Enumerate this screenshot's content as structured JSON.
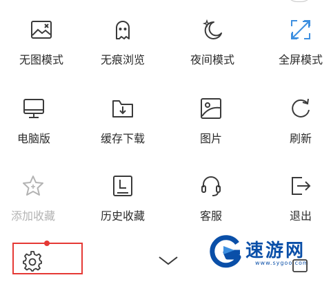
{
  "menu": {
    "rows": [
      [
        {
          "label": "无图模式",
          "icon": "no-image-icon",
          "enabled": true,
          "accent": false
        },
        {
          "label": "无痕浏览",
          "icon": "ghost-icon",
          "enabled": true,
          "accent": false
        },
        {
          "label": "夜间模式",
          "icon": "moon-icon",
          "enabled": true,
          "accent": false
        },
        {
          "label": "全屏模式",
          "icon": "fullscreen-icon",
          "enabled": true,
          "accent": true
        }
      ],
      [
        {
          "label": "电脑版",
          "icon": "monitor-icon",
          "enabled": true,
          "accent": false
        },
        {
          "label": "缓存下载",
          "icon": "download-folder-icon",
          "enabled": true,
          "accent": false
        },
        {
          "label": "图片",
          "icon": "image-icon",
          "enabled": true,
          "accent": false
        },
        {
          "label": "刷新",
          "icon": "refresh-icon",
          "enabled": true,
          "accent": false
        }
      ],
      [
        {
          "label": "添加收藏",
          "icon": "star-icon",
          "enabled": false,
          "accent": false
        },
        {
          "label": "历史收藏",
          "icon": "history-icon",
          "enabled": true,
          "accent": false
        },
        {
          "label": "客服",
          "icon": "headset-icon",
          "enabled": true,
          "accent": false
        },
        {
          "label": "退出",
          "icon": "exit-icon",
          "enabled": true,
          "accent": false
        }
      ]
    ]
  },
  "bottom_bar": {
    "settings_icon": "gear-icon",
    "collapse_icon": "chevron-down-icon",
    "highlight_color": "#e53935"
  },
  "watermark": {
    "text": "速游网",
    "sub": "www.sygoo.com",
    "color": "#0a4fa8"
  },
  "colors": {
    "icon": "#3a3a3a",
    "accent": "#3d8fe0",
    "disabled": "#b3b3b3"
  }
}
